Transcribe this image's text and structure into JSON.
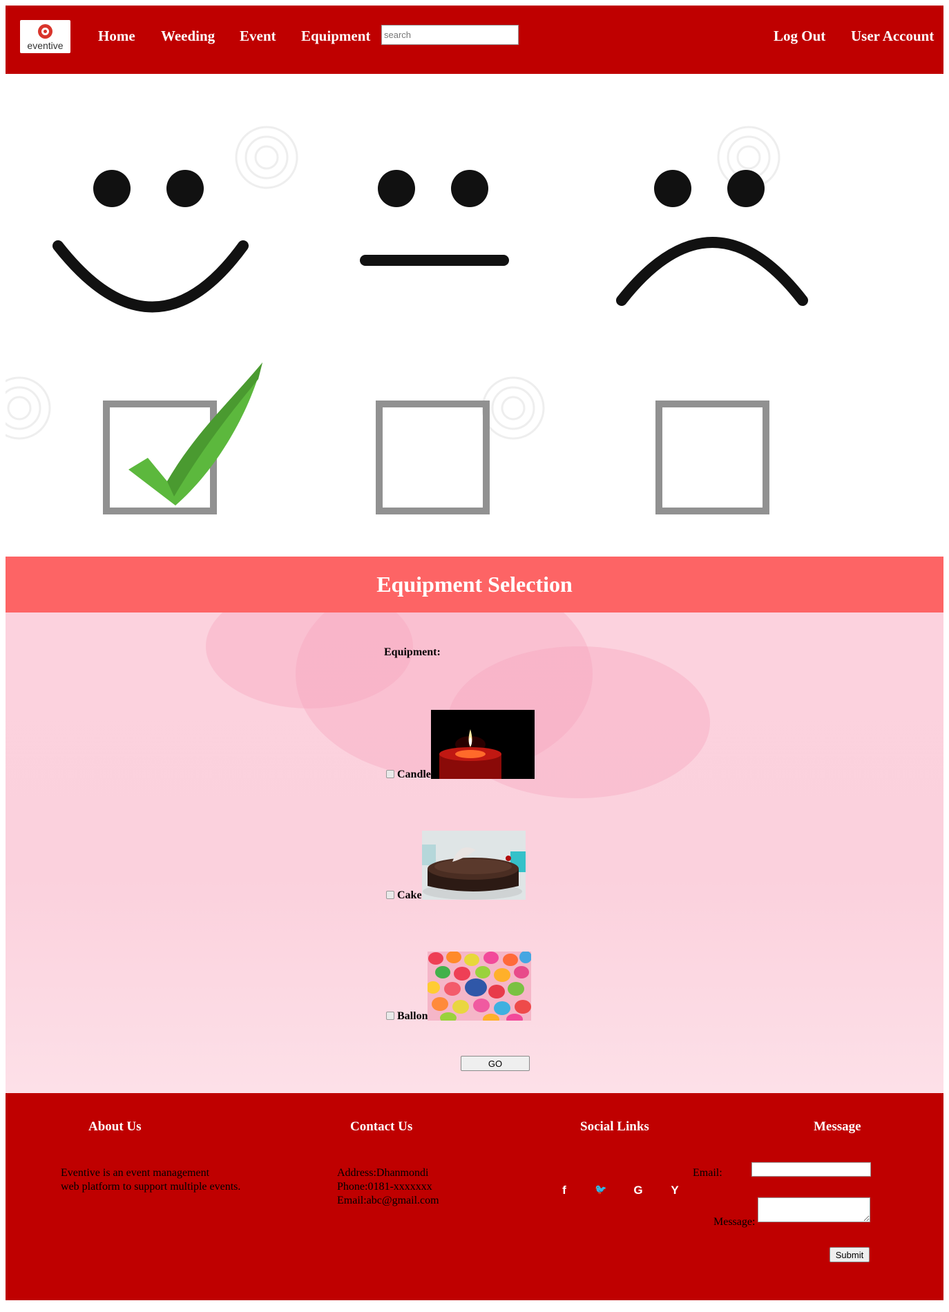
{
  "header": {
    "logo_text": "eventive",
    "nav": [
      "Home",
      "Weeding",
      "Event",
      "Equipment"
    ],
    "search_placeholder": "search",
    "logout": "Log Out",
    "account": "User Account"
  },
  "selection": {
    "title": "Equipment Selection",
    "label": "Equipment:",
    "items": [
      {
        "label": "Candle",
        "checked": false
      },
      {
        "label": "Cake",
        "checked": false
      },
      {
        "label": "Ballon",
        "checked": false
      }
    ],
    "go_label": "GO"
  },
  "footer": {
    "about": {
      "heading": "About Us",
      "line1": "Eventive is an event management",
      "line2": "web platform to support multiple events."
    },
    "contact": {
      "heading": "Contact Us",
      "address": "Address:Dhanmondi",
      "phone": "Phone:0181-xxxxxxx",
      "email": "Email:abc@gmail.com"
    },
    "social": {
      "heading": "Social Links",
      "icons": [
        "f",
        "🐦",
        "G",
        "Y"
      ]
    },
    "message": {
      "heading": "Message",
      "email_label": "Email:",
      "message_label": "Message:",
      "submit": "Submit"
    }
  },
  "colors": {
    "header_bg": "#bf0000",
    "section_header_bg": "#fd6465",
    "check_green": "#5cb83d"
  }
}
